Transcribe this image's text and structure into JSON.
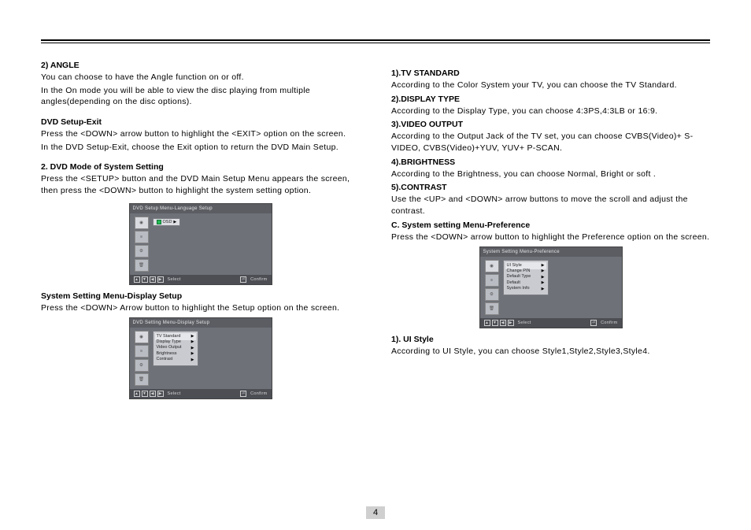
{
  "page_number": "4",
  "left": {
    "angle_h": "2) ANGLE",
    "angle_p1": "You can choose to have the Angle function on or off.",
    "angle_p2": "In the On mode you will be able to view the disc playing from multiple angles(depending on the disc options).",
    "exit_h": "DVD Setup-Exit",
    "exit_p1": "Press the <DOWN> arrow button to highlight the <EXIT> option on the screen.",
    "exit_p2": "In the DVD Setup-Exit, choose the Exit option to return the DVD Main Setup.",
    "mode_h": "2. DVD Mode of System Setting",
    "mode_p": "Press the <SETUP> button and  the DVD Main Setup Menu appears the screen, then press the <DOWN> button to highlight the system setting option.",
    "shot1": {
      "bar": "DVD Setup Menu-Language Setup",
      "osd": "OSD",
      "foot_select": "Select",
      "foot_confirm": "Confirm"
    },
    "disp_h": "System Setting Menu-Display Setup",
    "disp_p": "Press the <DOWN> Arrow button to highlight the Setup option on the screen.",
    "shot2": {
      "bar": "DVD Setting Menu-Display Setup",
      "items": [
        "TV Standard",
        "Display Type",
        "Video Output",
        "Brightness",
        "Contrast"
      ],
      "foot_select": "Select",
      "foot_confirm": "Confirm"
    }
  },
  "right": {
    "tv_h": "1).TV STANDARD",
    "tv_p": "According to the Color System your TV, you can choose the TV Standard.",
    "dt_h": "2).DISPLAY TYPE",
    "dt_p": "According to the Display Type, you can choose 4:3PS,4:3LB or 16:9.",
    "vo_h": "3).VIDEO OUTPUT",
    "vo_p": "According to the Output Jack of the TV set, you can choose CVBS(Video)+ S-VIDEO, CVBS(Video)+YUV, YUV+ P-SCAN.",
    "br_h": "4).BRIGHTNESS",
    "br_p": "According to the Brightness, you can choose Normal, Bright or soft .",
    "ct_h": "5).CONTRAST",
    "ct_p": "Use the <UP> and <DOWN> arrow buttons to move the scroll and adjust the contrast.",
    "pref_h": "C. System setting Menu-Preference",
    "pref_p": "Press the <DOWN> arrow button to highlight the Preference option on the screen.",
    "shot3": {
      "bar": "System Setting Menu-Preference",
      "items": [
        "UI Style",
        "Change PIN",
        "Default Type",
        "Default",
        "System Info"
      ],
      "foot_select": "Select",
      "foot_confirm": "Confirm"
    },
    "ui_h": "1). UI Style",
    "ui_p": "According to UI Style, you can choose Style1,Style2,Style3,Style4."
  }
}
